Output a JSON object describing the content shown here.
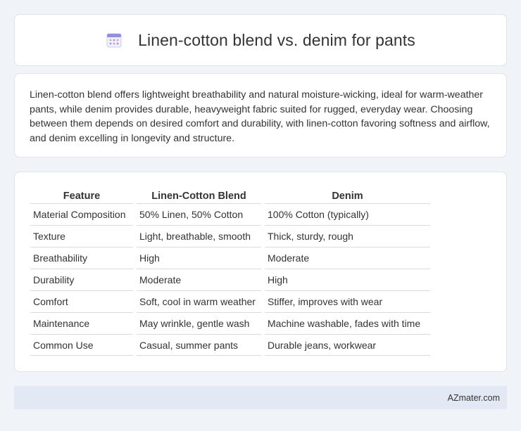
{
  "header": {
    "title": "Linen-cotton blend vs. denim for pants",
    "icon": "calendar-icon"
  },
  "summary": {
    "text": "Linen-cotton blend offers lightweight breathability and natural moisture-wicking, ideal for warm-weather pants, while denim provides durable, heavyweight fabric suited for rugged, everyday wear. Choosing between them depends on desired comfort and durability, with linen-cotton favoring softness and airflow, and denim excelling in longevity and structure."
  },
  "table": {
    "headers": [
      "Feature",
      "Linen-Cotton Blend",
      "Denim"
    ],
    "rows": [
      [
        "Material Composition",
        "50% Linen, 50% Cotton",
        "100% Cotton (typically)"
      ],
      [
        "Texture",
        "Light, breathable, smooth",
        "Thick, sturdy, rough"
      ],
      [
        "Breathability",
        "High",
        "Moderate"
      ],
      [
        "Durability",
        "Moderate",
        "High"
      ],
      [
        "Comfort",
        "Soft, cool in warm weather",
        "Stiffer, improves with wear"
      ],
      [
        "Maintenance",
        "May wrinkle, gentle wash",
        "Machine washable, fades with time"
      ],
      [
        "Common Use",
        "Casual, summer pants",
        "Durable jeans, workwear"
      ]
    ]
  },
  "footer": {
    "text": "AZmater.com"
  }
}
